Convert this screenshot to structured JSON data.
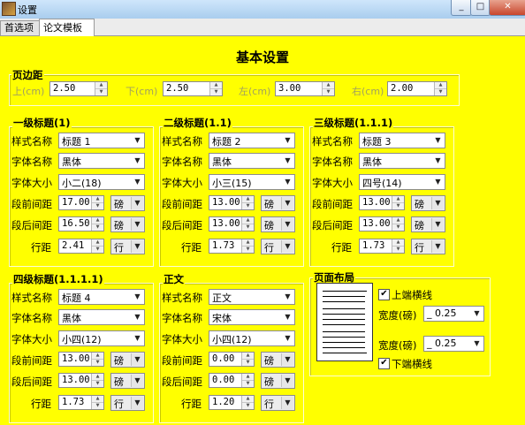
{
  "window": {
    "title": "设置",
    "min": "_",
    "max": "□",
    "close": "✕"
  },
  "tabs": [
    "首选项",
    "论文模板"
  ],
  "page_title": "基本设置",
  "margins": {
    "group_label": "页边距",
    "fields": [
      {
        "label": "上(cm)",
        "value": "2.50"
      },
      {
        "label": "下(cm)",
        "value": "2.50"
      },
      {
        "label": "左(cm)",
        "value": "3.00"
      },
      {
        "label": "右(cm)",
        "value": "2.00"
      }
    ]
  },
  "field_labels": {
    "style": "样式名称",
    "font": "字体名称",
    "size": "字体大小",
    "before": "段前间距",
    "after": "段后间距",
    "line": "行距"
  },
  "headings": [
    {
      "title": "一级标题(1)",
      "style": "标题 1",
      "font": "黑体",
      "size": "小二(18)",
      "before": "17.00",
      "before_unit": "磅",
      "after": "16.50",
      "after_unit": "磅",
      "line": "2.41",
      "line_unit": "行"
    },
    {
      "title": "二级标题(1.1)",
      "style": "标题 2",
      "font": "黑体",
      "size": "小三(15)",
      "before": "13.00",
      "before_unit": "磅",
      "after": "13.00",
      "after_unit": "磅",
      "line": "1.73",
      "line_unit": "行"
    },
    {
      "title": "三级标题(1.1.1)",
      "style": "标题 3",
      "font": "黑体",
      "size": "四号(14)",
      "before": "13.00",
      "before_unit": "磅",
      "after": "13.00",
      "after_unit": "磅",
      "line": "1.73",
      "line_unit": "行"
    },
    {
      "title": "四级标题(1.1.1.1)",
      "style": "标题 4",
      "font": "黑体",
      "size": "小四(12)",
      "before": "13.00",
      "before_unit": "磅",
      "after": "13.00",
      "after_unit": "磅",
      "line": "1.73",
      "line_unit": "行"
    },
    {
      "title": "正文",
      "style": "正文",
      "font": "宋体",
      "size": "小四(12)",
      "before": "0.00",
      "before_unit": "磅",
      "after": "0.00",
      "after_unit": "磅",
      "line": "1.20",
      "line_unit": "行"
    }
  ],
  "layout": {
    "title": "页面布局",
    "top_line_label": "上端横线",
    "top_line_checked": true,
    "width1_label": "宽度(磅)",
    "width1_value": "_ 0.25",
    "width2_label": "宽度(磅)",
    "width2_value": "_ 0.25",
    "bottom_line_label": "下端横线",
    "bottom_line_checked": true
  },
  "icons": {
    "check": "✔",
    "dropdown": "▼",
    "spin_up": "▲",
    "spin_down": "▼"
  }
}
